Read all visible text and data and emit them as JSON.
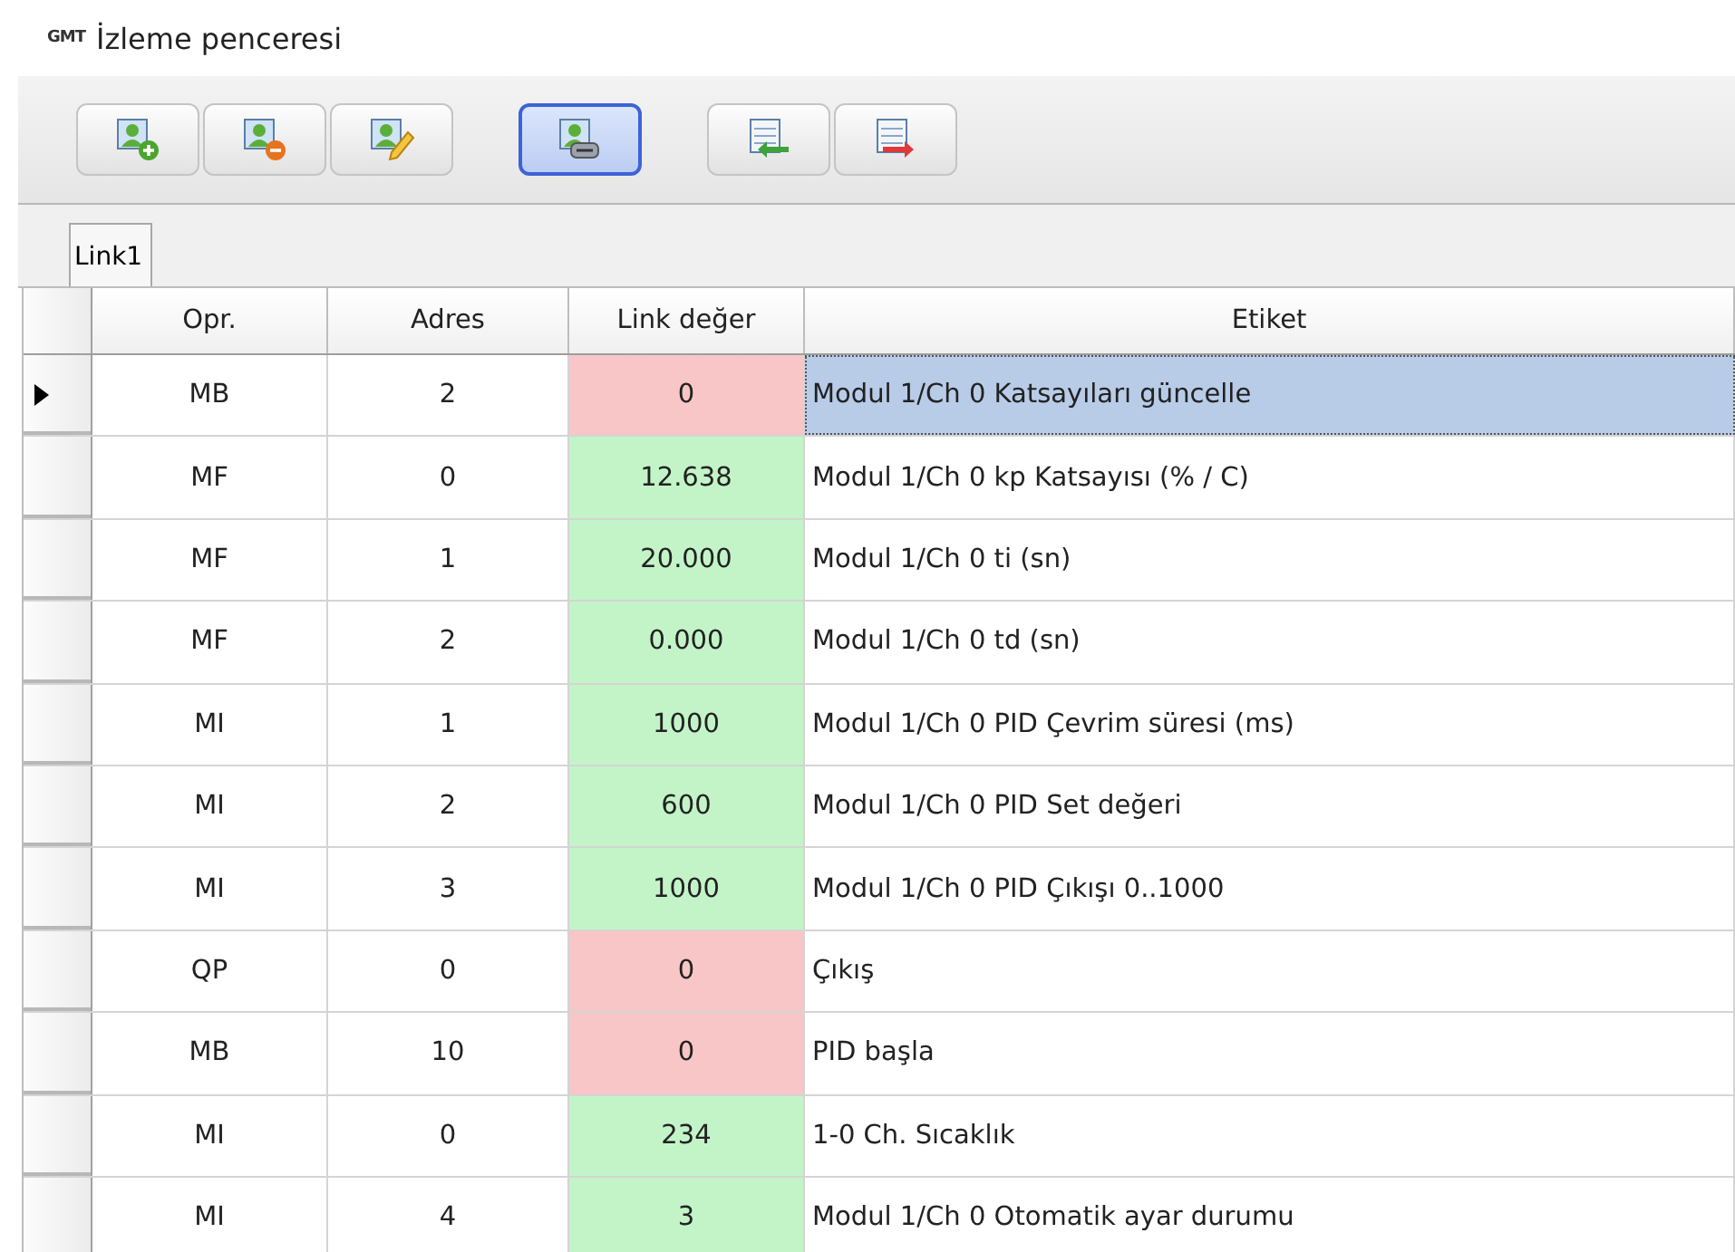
{
  "window": {
    "logo": "GMT",
    "title": "İzleme penceresi"
  },
  "toolbar": [
    {
      "kind": "add",
      "pressed": false
    },
    {
      "kind": "remove",
      "pressed": false
    },
    {
      "kind": "edit",
      "pressed": false
    },
    {
      "kind": "link",
      "pressed": true
    },
    {
      "kind": "import",
      "pressed": false
    },
    {
      "kind": "export",
      "pressed": false
    }
  ],
  "tabs": [
    {
      "label": "Link1",
      "selected": true
    }
  ],
  "table": {
    "columns": [
      "Opr.",
      "Adres",
      "Link değer",
      "Etiket"
    ],
    "rows": [
      {
        "opr": "MB",
        "adres": "2",
        "value": "0",
        "color": "#f8c6c6",
        "label": "Modul 1/Ch 0 Katsayıları güncelle",
        "selected": true
      },
      {
        "opr": "MF",
        "adres": "0",
        "value": "12.638",
        "color": "#c3f4c8",
        "label": "Modul 1/Ch 0 kp Katsayısı (% / C)",
        "selected": false
      },
      {
        "opr": "MF",
        "adres": "1",
        "value": "20.000",
        "color": "#c3f4c8",
        "label": "Modul 1/Ch 0 ti (sn)",
        "selected": false
      },
      {
        "opr": "MF",
        "adres": "2",
        "value": "0.000",
        "color": "#c3f4c8",
        "label": "Modul 1/Ch 0 td (sn)",
        "selected": false
      },
      {
        "opr": "MI",
        "adres": "1",
        "value": "1000",
        "color": "#c3f4c8",
        "label": "Modul 1/Ch 0 PID Çevrim süresi (ms)",
        "selected": false
      },
      {
        "opr": "MI",
        "adres": "2",
        "value": "600",
        "color": "#c3f4c8",
        "label": "Modul 1/Ch 0 PID Set değeri",
        "selected": false
      },
      {
        "opr": "MI",
        "adres": "3",
        "value": "1000",
        "color": "#c3f4c8",
        "label": "Modul 1/Ch 0 PID Çıkışı 0..1000",
        "selected": false
      },
      {
        "opr": "QP",
        "adres": "0",
        "value": "0",
        "color": "#f8c6c6",
        "label": "Çıkış",
        "selected": false
      },
      {
        "opr": "MB",
        "adres": "10",
        "value": "0",
        "color": "#f8c6c6",
        "label": "PID başla",
        "selected": false
      },
      {
        "opr": "MI",
        "adres": "0",
        "value": "234",
        "color": "#c3f4c8",
        "label": "1-0 Ch. Sıcaklık",
        "selected": false
      },
      {
        "opr": "MI",
        "adres": "4",
        "value": "3",
        "color": "#c3f4c8",
        "label": "Modul 1/Ch 0 Otomatik ayar durumu",
        "selected": false
      }
    ]
  }
}
